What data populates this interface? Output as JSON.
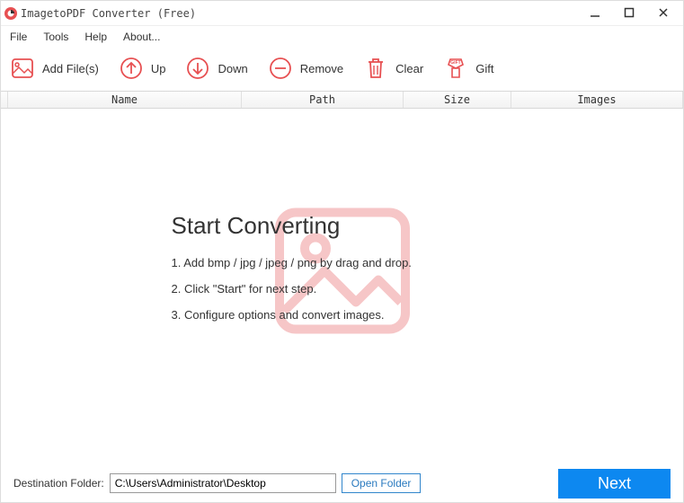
{
  "title": "ImagetoPDF Converter (Free)",
  "menu": {
    "file": "File",
    "tools": "Tools",
    "help": "Help",
    "about": "About..."
  },
  "toolbar": {
    "add": "Add File(s)",
    "up": "Up",
    "down": "Down",
    "remove": "Remove",
    "clear": "Clear",
    "gift": "Gift"
  },
  "columns": {
    "name": "Name",
    "path": "Path",
    "size": "Size",
    "images": "Images"
  },
  "placeholder": {
    "heading": "Start Converting",
    "step1": "1. Add bmp / jpg / jpeg / png by drag and drop.",
    "step2": "2. Click \"Start\" for next step.",
    "step3": "3. Configure options and convert images."
  },
  "bottom": {
    "dest_label": "Destination Folder:",
    "dest_value": "C:\\Users\\Administrator\\Desktop",
    "open_folder": "Open Folder",
    "next": "Next"
  },
  "colors": {
    "accent": "#e75052",
    "primary": "#0d88f0"
  }
}
